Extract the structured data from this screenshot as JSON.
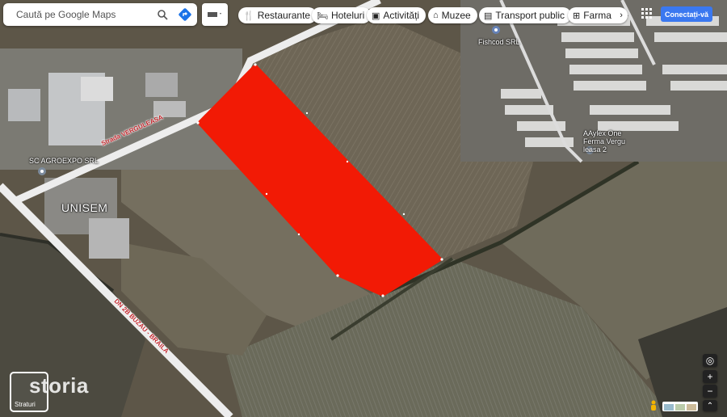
{
  "search": {
    "placeholder": "Caută pe Google Maps"
  },
  "chips": [
    {
      "icon": "utensils-icon",
      "glyph": "🍴",
      "label": "Restaurante"
    },
    {
      "icon": "bed-icon",
      "glyph": "🛏",
      "label": "Hoteluri"
    },
    {
      "icon": "camera-icon",
      "glyph": "▣",
      "label": "Activități"
    },
    {
      "icon": "museum-icon",
      "glyph": "⌂",
      "label": "Muzee"
    },
    {
      "icon": "bus-icon",
      "glyph": "▤",
      "label": "Transport public"
    },
    {
      "icon": "pharmacy-icon",
      "glyph": "⊞",
      "label": "Farma"
    }
  ],
  "connect_label": "Conectați-vă",
  "places": {
    "agroexpo": "SC AGROEXPO SRL",
    "unisem": "UNISEM",
    "fishcod": "Fishcod SRL",
    "ferma": "AAylex One Ferma Vergu leasa 2"
  },
  "roads": {
    "strada": "Strada VERGULEASA",
    "dn": "DN 2B BUZAU - BRAILA"
  },
  "watermark": "storia",
  "layers_label": "Straturi",
  "colors": {
    "highlight": "#f21a05",
    "button_blue": "#3a78f0"
  }
}
